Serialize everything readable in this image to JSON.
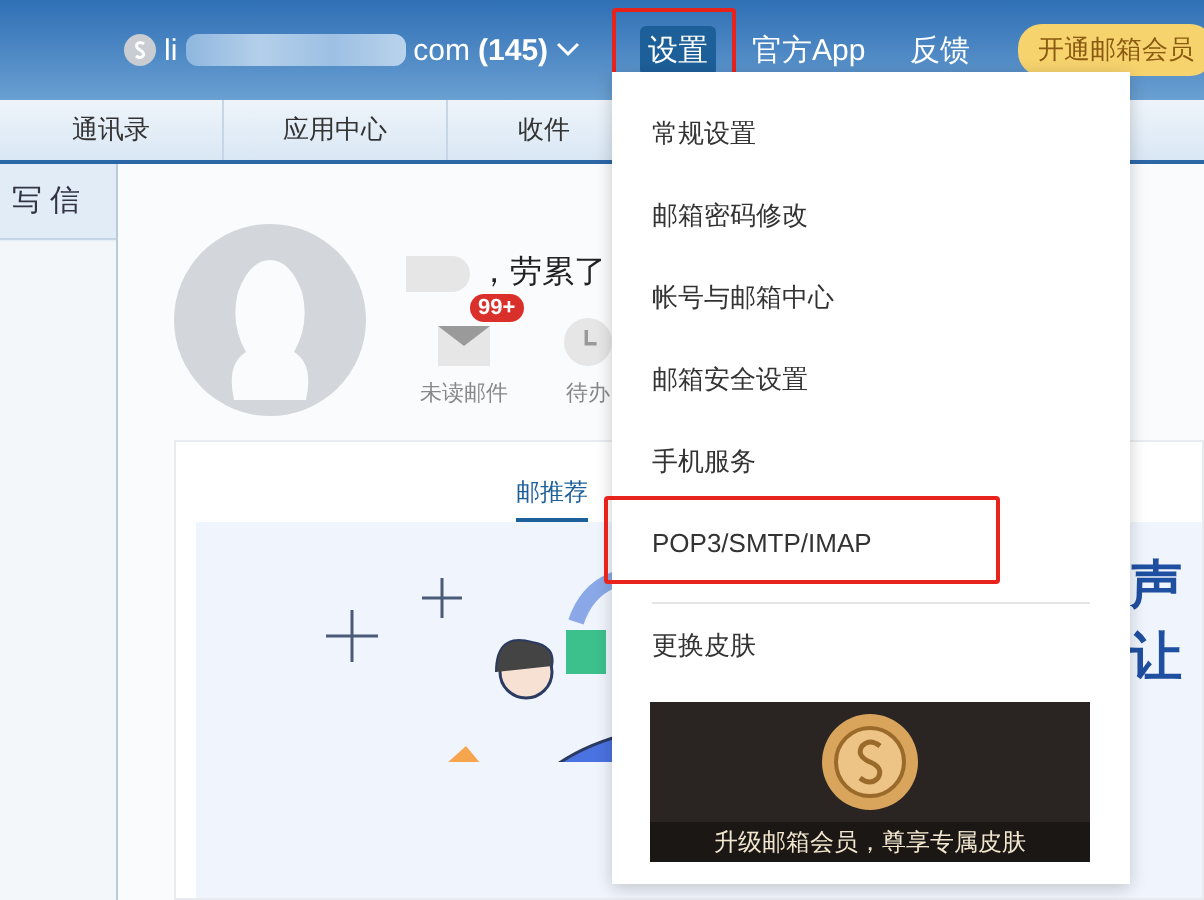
{
  "header": {
    "account": {
      "prefix": "li",
      "suffix": "com",
      "count": "(145)"
    },
    "links": [
      {
        "label": "设置",
        "selected": true,
        "highlighted": true
      },
      {
        "label": "官方App",
        "selected": false,
        "highlighted": false
      },
      {
        "label": "反馈",
        "selected": false,
        "highlighted": false
      }
    ],
    "vip_button": "开通邮箱会员"
  },
  "nav_tabs": [
    "通讯录",
    "应用中心",
    "收件"
  ],
  "sidebar": {
    "compose": "写 信"
  },
  "profile": {
    "greeting": "，劳累了",
    "stats": [
      {
        "kind": "mail",
        "label": "未读邮件",
        "badge": "99+"
      },
      {
        "kind": "todo",
        "label": "待办"
      }
    ]
  },
  "card": {
    "tabs": [
      {
        "label": "邮推荐",
        "selected": true
      }
    ],
    "banner_lines": [
      "声",
      "让"
    ]
  },
  "settings_menu": {
    "items": [
      {
        "label": "常规设置",
        "highlighted": false
      },
      {
        "label": "邮箱密码修改",
        "highlighted": false
      },
      {
        "label": "帐号与邮箱中心",
        "highlighted": false
      },
      {
        "label": "邮箱安全设置",
        "highlighted": false
      },
      {
        "label": "手机服务",
        "highlighted": false
      },
      {
        "label": "POP3/SMTP/IMAP",
        "highlighted": true
      }
    ],
    "skin": "更换皮肤",
    "promo_caption": "升级邮箱会员，尊享专属皮肤"
  }
}
